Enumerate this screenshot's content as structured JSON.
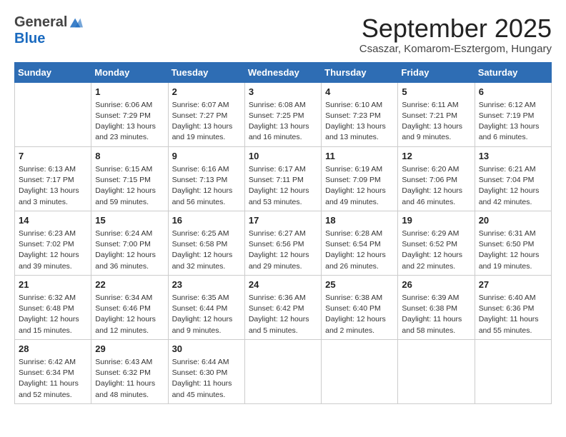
{
  "header": {
    "logo_general": "General",
    "logo_blue": "Blue",
    "month_title": "September 2025",
    "location": "Csaszar, Komarom-Esztergom, Hungary"
  },
  "days_of_week": [
    "Sunday",
    "Monday",
    "Tuesday",
    "Wednesday",
    "Thursday",
    "Friday",
    "Saturday"
  ],
  "weeks": [
    [
      {
        "day": "",
        "text": ""
      },
      {
        "day": "1",
        "text": "Sunrise: 6:06 AM\nSunset: 7:29 PM\nDaylight: 13 hours\nand 23 minutes."
      },
      {
        "day": "2",
        "text": "Sunrise: 6:07 AM\nSunset: 7:27 PM\nDaylight: 13 hours\nand 19 minutes."
      },
      {
        "day": "3",
        "text": "Sunrise: 6:08 AM\nSunset: 7:25 PM\nDaylight: 13 hours\nand 16 minutes."
      },
      {
        "day": "4",
        "text": "Sunrise: 6:10 AM\nSunset: 7:23 PM\nDaylight: 13 hours\nand 13 minutes."
      },
      {
        "day": "5",
        "text": "Sunrise: 6:11 AM\nSunset: 7:21 PM\nDaylight: 13 hours\nand 9 minutes."
      },
      {
        "day": "6",
        "text": "Sunrise: 6:12 AM\nSunset: 7:19 PM\nDaylight: 13 hours\nand 6 minutes."
      }
    ],
    [
      {
        "day": "7",
        "text": "Sunrise: 6:13 AM\nSunset: 7:17 PM\nDaylight: 13 hours\nand 3 minutes."
      },
      {
        "day": "8",
        "text": "Sunrise: 6:15 AM\nSunset: 7:15 PM\nDaylight: 12 hours\nand 59 minutes."
      },
      {
        "day": "9",
        "text": "Sunrise: 6:16 AM\nSunset: 7:13 PM\nDaylight: 12 hours\nand 56 minutes."
      },
      {
        "day": "10",
        "text": "Sunrise: 6:17 AM\nSunset: 7:11 PM\nDaylight: 12 hours\nand 53 minutes."
      },
      {
        "day": "11",
        "text": "Sunrise: 6:19 AM\nSunset: 7:09 PM\nDaylight: 12 hours\nand 49 minutes."
      },
      {
        "day": "12",
        "text": "Sunrise: 6:20 AM\nSunset: 7:06 PM\nDaylight: 12 hours\nand 46 minutes."
      },
      {
        "day": "13",
        "text": "Sunrise: 6:21 AM\nSunset: 7:04 PM\nDaylight: 12 hours\nand 42 minutes."
      }
    ],
    [
      {
        "day": "14",
        "text": "Sunrise: 6:23 AM\nSunset: 7:02 PM\nDaylight: 12 hours\nand 39 minutes."
      },
      {
        "day": "15",
        "text": "Sunrise: 6:24 AM\nSunset: 7:00 PM\nDaylight: 12 hours\nand 36 minutes."
      },
      {
        "day": "16",
        "text": "Sunrise: 6:25 AM\nSunset: 6:58 PM\nDaylight: 12 hours\nand 32 minutes."
      },
      {
        "day": "17",
        "text": "Sunrise: 6:27 AM\nSunset: 6:56 PM\nDaylight: 12 hours\nand 29 minutes."
      },
      {
        "day": "18",
        "text": "Sunrise: 6:28 AM\nSunset: 6:54 PM\nDaylight: 12 hours\nand 26 minutes."
      },
      {
        "day": "19",
        "text": "Sunrise: 6:29 AM\nSunset: 6:52 PM\nDaylight: 12 hours\nand 22 minutes."
      },
      {
        "day": "20",
        "text": "Sunrise: 6:31 AM\nSunset: 6:50 PM\nDaylight: 12 hours\nand 19 minutes."
      }
    ],
    [
      {
        "day": "21",
        "text": "Sunrise: 6:32 AM\nSunset: 6:48 PM\nDaylight: 12 hours\nand 15 minutes."
      },
      {
        "day": "22",
        "text": "Sunrise: 6:34 AM\nSunset: 6:46 PM\nDaylight: 12 hours\nand 12 minutes."
      },
      {
        "day": "23",
        "text": "Sunrise: 6:35 AM\nSunset: 6:44 PM\nDaylight: 12 hours\nand 9 minutes."
      },
      {
        "day": "24",
        "text": "Sunrise: 6:36 AM\nSunset: 6:42 PM\nDaylight: 12 hours\nand 5 minutes."
      },
      {
        "day": "25",
        "text": "Sunrise: 6:38 AM\nSunset: 6:40 PM\nDaylight: 12 hours\nand 2 minutes."
      },
      {
        "day": "26",
        "text": "Sunrise: 6:39 AM\nSunset: 6:38 PM\nDaylight: 11 hours\nand 58 minutes."
      },
      {
        "day": "27",
        "text": "Sunrise: 6:40 AM\nSunset: 6:36 PM\nDaylight: 11 hours\nand 55 minutes."
      }
    ],
    [
      {
        "day": "28",
        "text": "Sunrise: 6:42 AM\nSunset: 6:34 PM\nDaylight: 11 hours\nand 52 minutes."
      },
      {
        "day": "29",
        "text": "Sunrise: 6:43 AM\nSunset: 6:32 PM\nDaylight: 11 hours\nand 48 minutes."
      },
      {
        "day": "30",
        "text": "Sunrise: 6:44 AM\nSunset: 6:30 PM\nDaylight: 11 hours\nand 45 minutes."
      },
      {
        "day": "",
        "text": ""
      },
      {
        "day": "",
        "text": ""
      },
      {
        "day": "",
        "text": ""
      },
      {
        "day": "",
        "text": ""
      }
    ]
  ]
}
